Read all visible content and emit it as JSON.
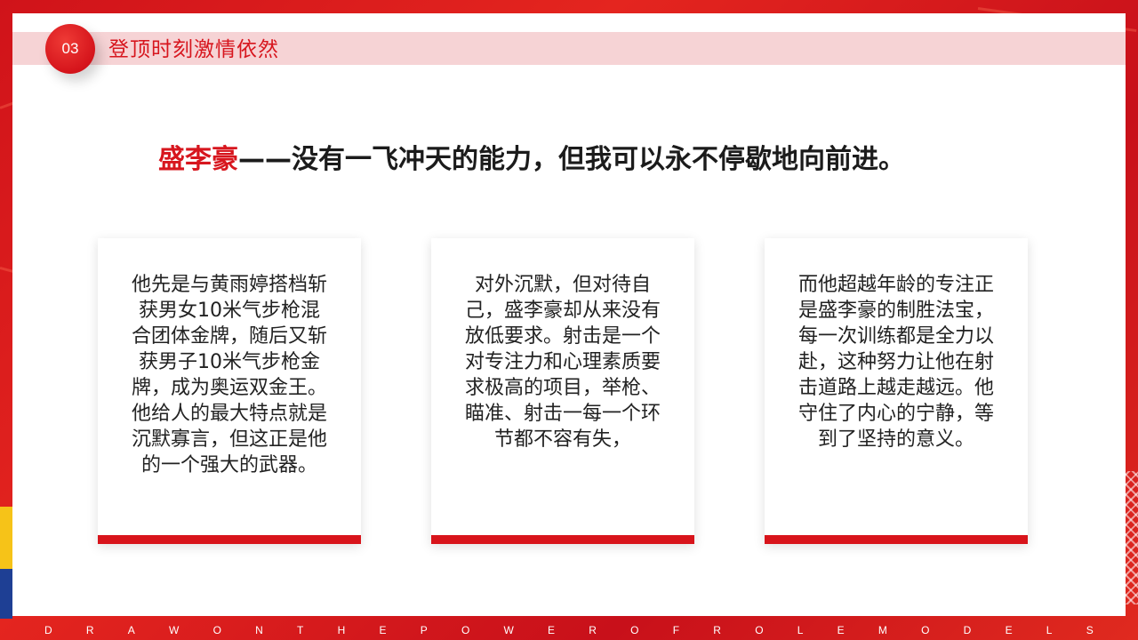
{
  "section": {
    "number": "03",
    "title": "登顶时刻激情依然"
  },
  "headline": {
    "name": "盛李豪",
    "rest": "——没有一飞冲天的能力，但我可以永不停歇地向前进。"
  },
  "cards": [
    {
      "text": "他先是与黄雨婷搭档斩获男女10米气步枪混合团体金牌，随后又斩获男子10米气步枪金牌，成为奥运双金王。他给人的最大特点就是沉默寡言，但这正是他的一个强大的武器。"
    },
    {
      "text": "对外沉默，但对待自己，盛李豪却从来没有放低要求。射击是一个对专注力和心理素质要求极高的项目，举枪、瞄准、射击一每一个环节都不容有失，"
    },
    {
      "text": "而他超越年龄的专注正是盛李豪的制胜法宝，每一次训练都是全力以赴，这种努力让他在射击道路上越走越远。他守住了内心的宁静，等到了坚持的意义。"
    }
  ],
  "footer": {
    "letters": [
      "D",
      "R",
      "A",
      "W",
      "O",
      "N",
      "T",
      "H",
      "E",
      "P",
      "O",
      "W",
      "E",
      "R",
      "O",
      "F",
      "R",
      "O",
      "L",
      "E",
      "M",
      "O",
      "D",
      "E",
      "L",
      "S"
    ]
  },
  "colors": {
    "accent": "#d7161e",
    "header_band": "#f6d3d5",
    "text": "#222222"
  }
}
